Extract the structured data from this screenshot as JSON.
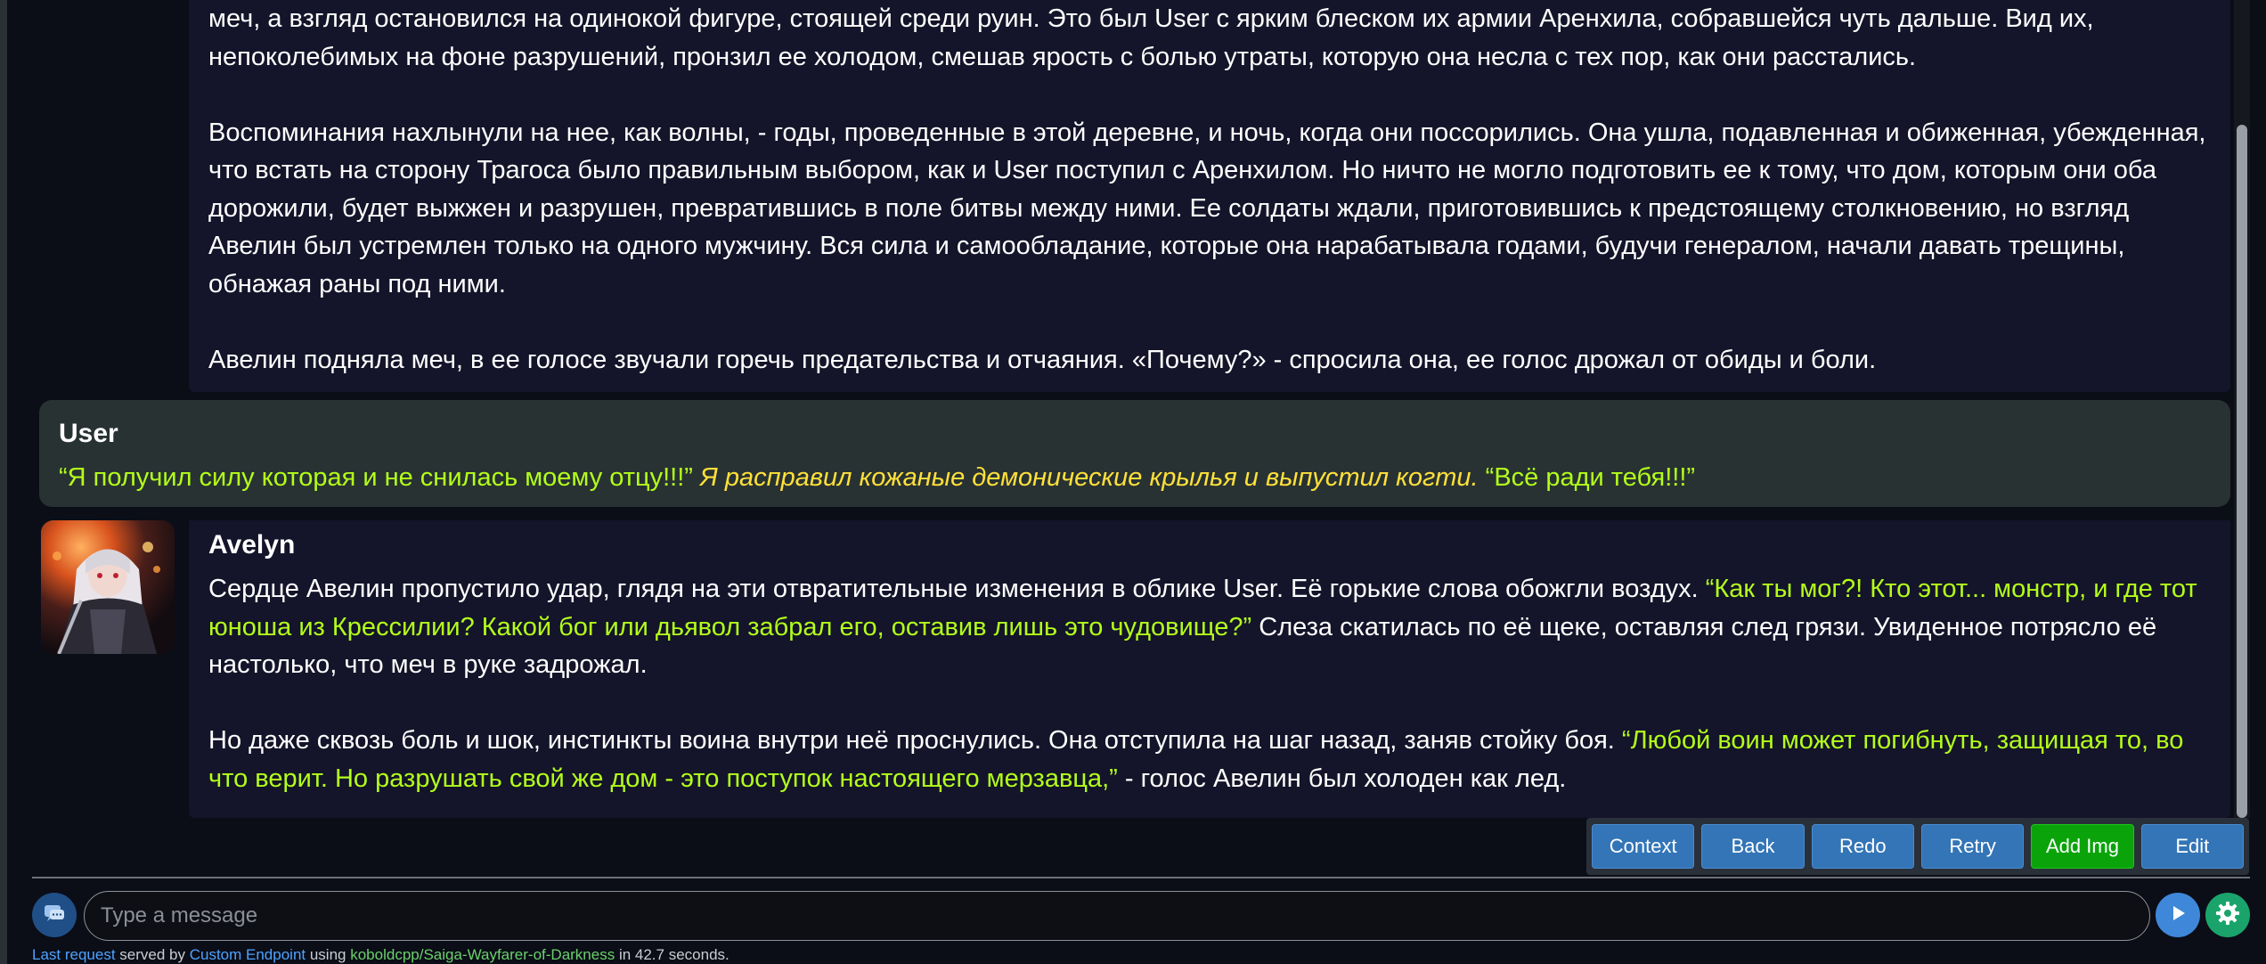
{
  "chat": {
    "messages": [
      {
        "type": "ai",
        "paragraphs": [
          [
            {
              "style": "narration",
              "text": "меч, а взгляд остановился на одинокой фигуре, стоящей среди руин. Это был User с ярким блеском их армии Аренхила, собравшейся чуть дальше. Вид их, непоколебимых на фоне разрушений, пронзил ее холодом, смешав ярость с болью утраты, которую она несла с тех пор, как они расстались."
            }
          ],
          [
            {
              "style": "narration",
              "text": "Воспоминания нахлынули на нее, как волны, - годы, проведенные в этой деревне, и ночь, когда они поссорились. Она ушла, подавленная и обиженная, убежденная, что встать на сторону Трагоса было правильным выбором, как и User поступил с Аренхилом. Но ничто не могло подготовить ее к тому, что дом, которым они оба дорожили, будет выжжен и разрушен, превратившись в поле битвы между ними. Ее солдаты ждали, приготовившись к предстоящему столкновению, но взгляд Авелин был устремлен только на одного мужчину. Вся сила и самообладание, которые она нарабатывала годами, будучи генералом, начали давать трещины, обнажая раны под ними."
            }
          ],
          [
            {
              "style": "narration",
              "text": "Авелин подняла меч, в ее голосе звучали горечь предательства и отчаяния. «Почему?» - спросила она, ее голос дрожал от обиды и боли."
            }
          ]
        ]
      },
      {
        "type": "user",
        "name": "User",
        "segments": [
          {
            "style": "speech",
            "text": "“Я получил силу которая и не снилась моему отцу!!!”"
          },
          {
            "style": "action",
            "text": " Я расправил кожаные демонические крылья и выпустил когти."
          },
          {
            "style": "speech",
            "text": " “Всё ради тебя!!!”"
          }
        ]
      },
      {
        "type": "ai",
        "name": "Avelyn",
        "avatar_icon": "character-avatar",
        "paragraphs": [
          [
            {
              "style": "narration",
              "text": "Сердце Авелин пропустило удар, глядя на эти отвратительные изменения в облике User. Её горькие слова обожгли воздух. "
            },
            {
              "style": "speech",
              "text": "“Как ты мог?! Кто этот... монстр, и где тот юноша из Крессилии? Какой бог или дьявол забрал его, оставив лишь это чудовище?”"
            },
            {
              "style": "narration",
              "text": " Слеза скатилась по её щеке, оставляя след грязи. Увиденное потрясло её настолько, что меч в руке задрожал."
            }
          ],
          [
            {
              "style": "narration",
              "text": "Но даже сквозь боль и шок, инстинкты воина внутри неё проснулись. Она отступила на шаг назад, заняв стойку боя. "
            },
            {
              "style": "speech",
              "text": "“Любой воин может погибнуть, защищая то, во что верит. Но разрушать свой же дом - это поступок настоящего мерзавца,”"
            },
            {
              "style": "narration",
              "text": " - голос Авелин был холоден как лед."
            }
          ]
        ]
      }
    ]
  },
  "actions": {
    "context": "Context",
    "back": "Back",
    "redo": "Redo",
    "retry": "Retry",
    "add_img": "Add Img",
    "edit": "Edit"
  },
  "input": {
    "placeholder": "Type a message",
    "value": ""
  },
  "status": {
    "last_request": "Last request",
    "served_by": " served by ",
    "endpoint": "Custom Endpoint",
    "using": " using ",
    "model": "koboldcpp/Saiga-Wayfarer-of-Darkness",
    "time": " in 42.7 seconds."
  },
  "colors": {
    "speech": "#b3ff1a",
    "action": "#ffe03a",
    "button": "#3375b7",
    "button_green": "#0aa40a"
  }
}
